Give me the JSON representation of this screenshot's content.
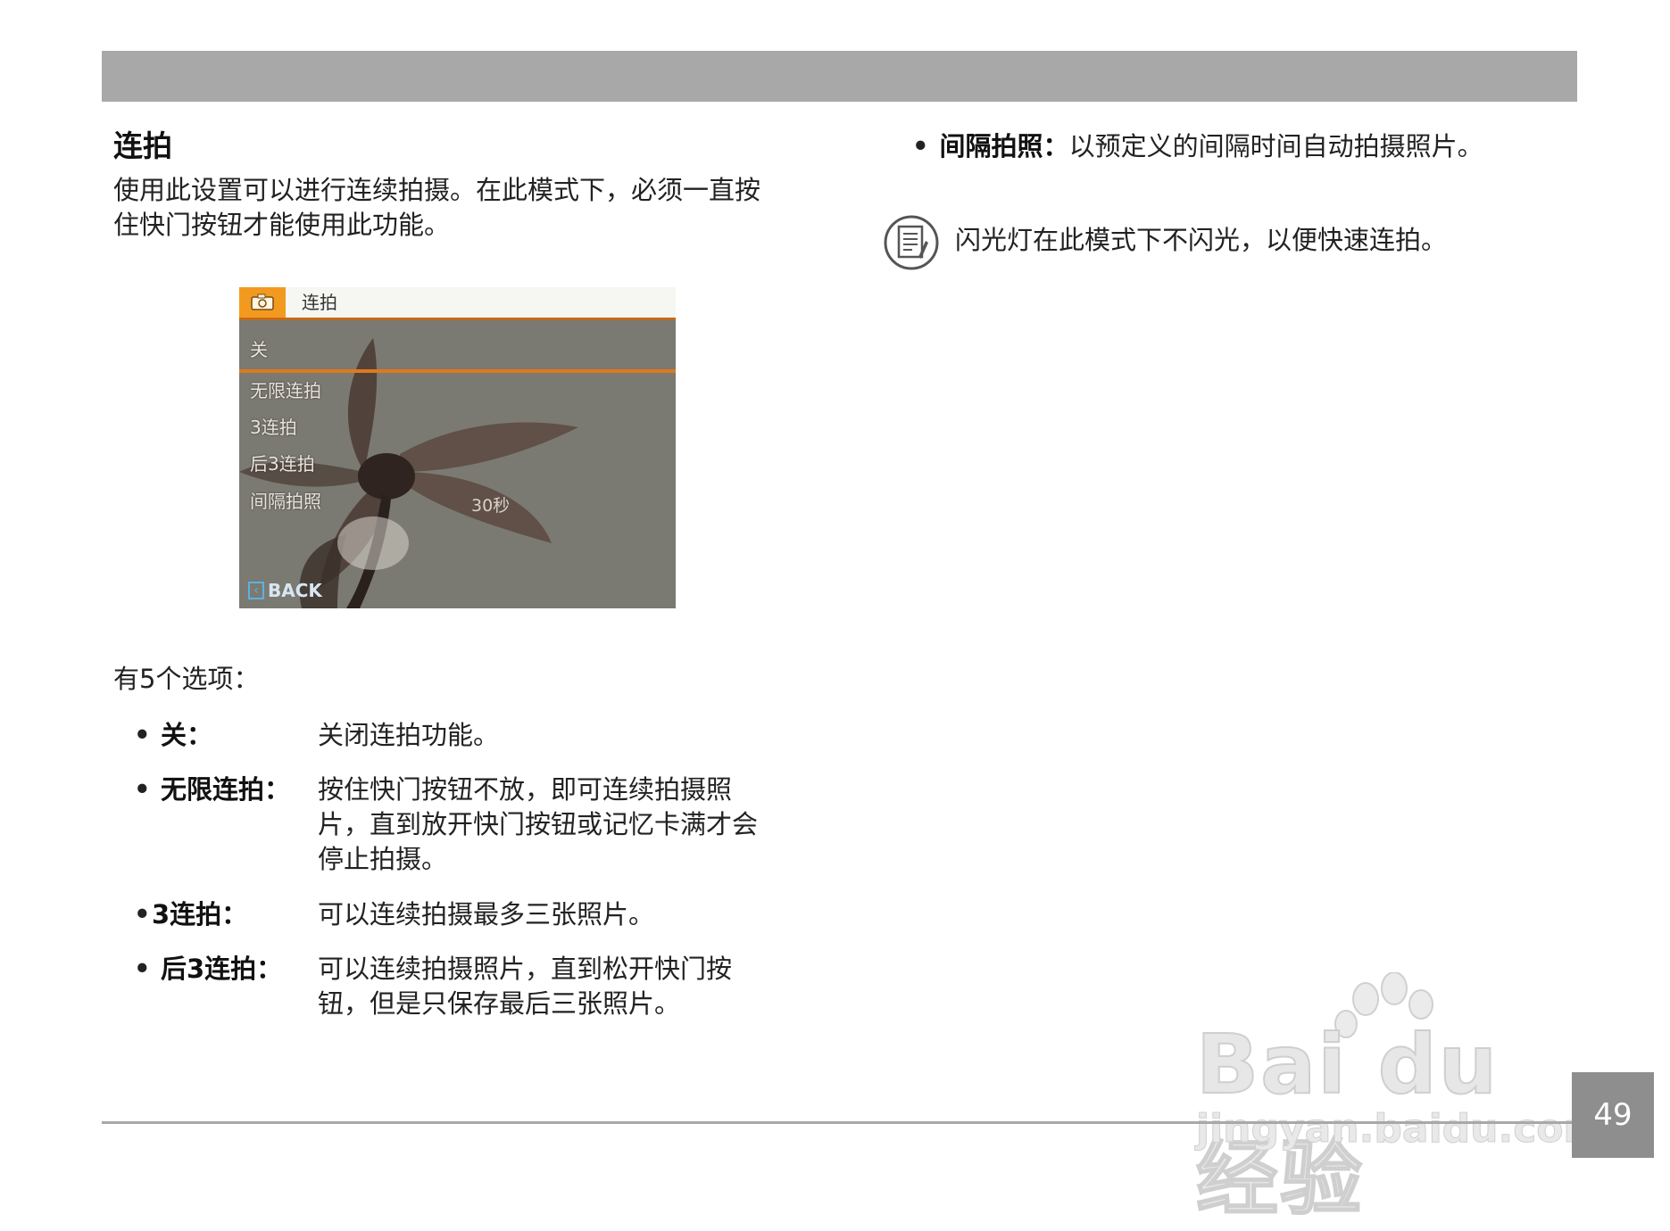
{
  "section_title": "连拍",
  "intro": "使用此设置可以进行连续拍摄。在此模式下，必须一直按住快门按钮才能使用此功能。",
  "camera_screen": {
    "title": "连拍",
    "items": [
      "关",
      "无限连拍",
      "3连拍",
      "后3连拍",
      "间隔拍照"
    ],
    "interval_value": "30秒",
    "back_label": "BACK",
    "colors": {
      "tab": "#f29a1f",
      "selection": "#e0791c",
      "back": "#5fb0e0"
    }
  },
  "options_intro": "有5个选项：",
  "options": [
    {
      "bullet": "•",
      "label": "关：",
      "desc": "关闭连拍功能。"
    },
    {
      "bullet": "•",
      "label": "无限连拍：",
      "desc": "按住快门按钮不放，即可连续拍摄照片，直到放开快门按钮或记忆卡满才会停止拍摄。"
    },
    {
      "bullet": "•",
      "label": "3连拍：",
      "desc": "可以连续拍摄最多三张照片。"
    },
    {
      "bullet": "•",
      "label": "后3连拍：",
      "desc": "可以连续拍摄照片，直到松开快门按钮，但是只保存最后三张照片。"
    }
  ],
  "right_bullet": {
    "bullet": "•",
    "label": "间隔拍照：",
    "desc": "以预定义的间隔时间自动拍摄照片。"
  },
  "note": {
    "icon": "note-icon",
    "text": "闪光灯在此模式下不闪光，以便快速连拍。"
  },
  "page_number": "49",
  "watermark": {
    "main": "Bai du 经验",
    "url": "jingyan.baidu.com"
  }
}
